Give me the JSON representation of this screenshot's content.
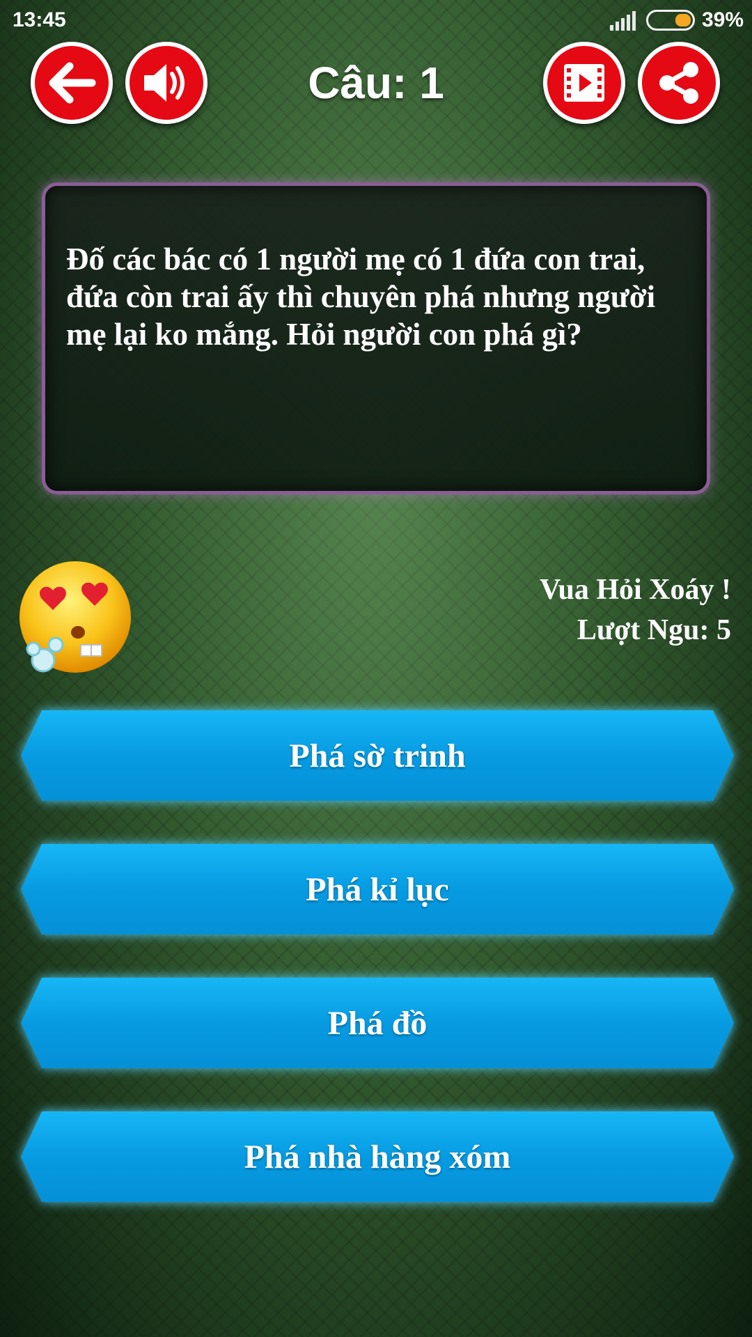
{
  "status_bar": {
    "time": "13:45",
    "battery": "39%"
  },
  "header": {
    "title": "Câu: 1",
    "back_icon": "arrow-left-icon",
    "sound_icon": "speaker-icon",
    "video_icon": "film-play-icon",
    "share_icon": "share-icon",
    "button_color": "#e50914"
  },
  "question": {
    "text": "Đố các bác có 1 người mẹ có 1 đứa con trai, đứa còn trai ấy thì chuyên phá nhưng người mẹ lại ko mắng. Hỏi người con phá gì?"
  },
  "info": {
    "title": "Vua Hỏi Xoáy !",
    "lives": "Lượt Ngu: 5"
  },
  "answers": [
    {
      "label": "Phá sờ trinh"
    },
    {
      "label": "Phá kỉ lục"
    },
    {
      "label": "Phá đồ"
    },
    {
      "label": "Phá nhà hàng xóm"
    }
  ],
  "colors": {
    "answer_blue": "#08a0e6",
    "question_border": "#8a5e95"
  }
}
